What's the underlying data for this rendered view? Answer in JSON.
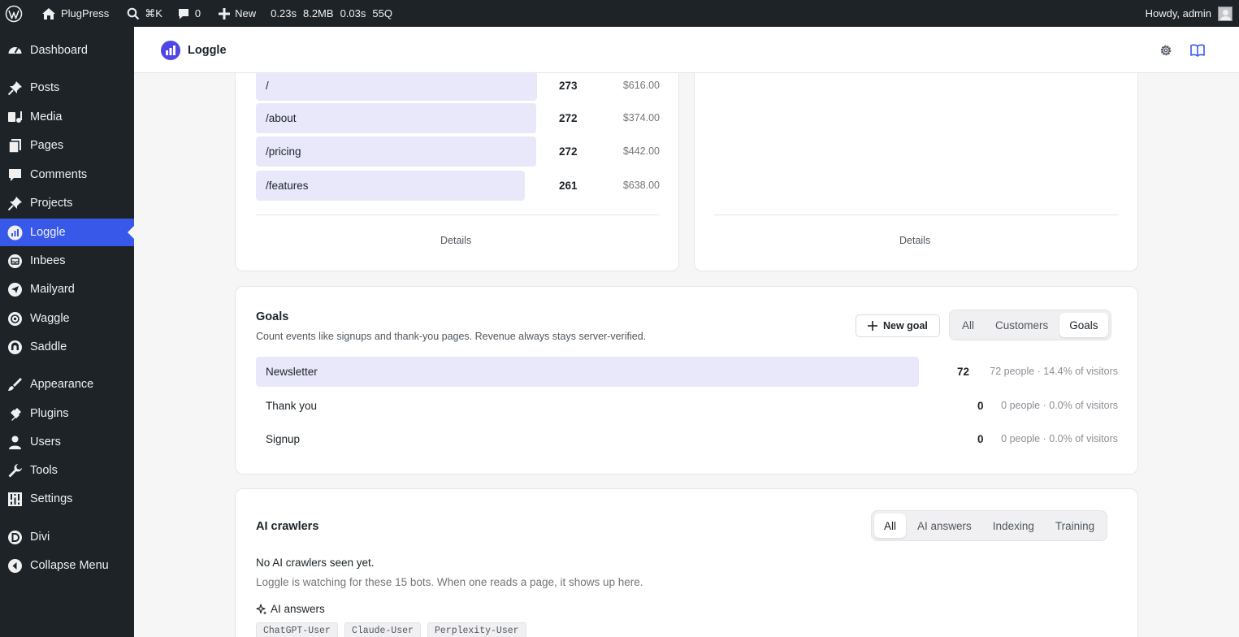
{
  "admin_bar": {
    "site_name": "PlugPress",
    "search_shortcut": "⌘K",
    "comments_count": "0",
    "new_label": "New",
    "perf": [
      "0.23s",
      "8.2MB",
      "0.03s",
      "55Q"
    ],
    "greeting": "Howdy, admin"
  },
  "sidebar": {
    "items": [
      {
        "label": "Dashboard",
        "icon": "dashboard-icon"
      },
      {
        "label": "Posts",
        "icon": "pin-icon"
      },
      {
        "label": "Media",
        "icon": "media-icon"
      },
      {
        "label": "Pages",
        "icon": "pages-icon"
      },
      {
        "label": "Comments",
        "icon": "comment-icon"
      },
      {
        "label": "Projects",
        "icon": "pin-icon"
      },
      {
        "label": "Loggle",
        "icon": "chart-icon",
        "current": true
      },
      {
        "label": "Inbees",
        "icon": "inbox-icon"
      },
      {
        "label": "Mailyard",
        "icon": "send-icon"
      },
      {
        "label": "Waggle",
        "icon": "waggle-icon"
      },
      {
        "label": "Saddle",
        "icon": "saddle-icon"
      },
      {
        "label": "Appearance",
        "icon": "brush-icon"
      },
      {
        "label": "Plugins",
        "icon": "plug-icon"
      },
      {
        "label": "Users",
        "icon": "user-icon"
      },
      {
        "label": "Tools",
        "icon": "wrench-icon"
      },
      {
        "label": "Settings",
        "icon": "settings-icon"
      },
      {
        "label": "Divi",
        "icon": "divi-icon"
      },
      {
        "label": "Collapse Menu",
        "icon": "collapse-icon"
      }
    ]
  },
  "plugin_header": {
    "title": "Loggle"
  },
  "pages_card": {
    "rows": [
      {
        "label": "/",
        "count": "273",
        "revenue": "$616.00",
        "share": 1.0
      },
      {
        "label": "/about",
        "count": "272",
        "revenue": "$374.00",
        "share": 0.996
      },
      {
        "label": "/pricing",
        "count": "272",
        "revenue": "$442.00",
        "share": 0.996
      },
      {
        "label": "/features",
        "count": "261",
        "revenue": "$638.00",
        "share": 0.956
      }
    ],
    "details_label": "Details"
  },
  "right_card": {
    "details_label": "Details"
  },
  "goals": {
    "title": "Goals",
    "subtitle": "Count events like signups and thank-you pages. Revenue always stays server-verified.",
    "new_goal_label": "New goal",
    "tabs": [
      {
        "label": "All",
        "active": false
      },
      {
        "label": "Customers",
        "active": false
      },
      {
        "label": "Goals",
        "active": true
      }
    ],
    "items": [
      {
        "label": "Newsletter",
        "count": "72",
        "sub": "72 people · 14.4% of visitors",
        "share": 1.0
      },
      {
        "label": "Thank you",
        "count": "0",
        "sub": "0 people · 0.0% of visitors",
        "share": 0
      },
      {
        "label": "Signup",
        "count": "0",
        "sub": "0 people · 0.0% of visitors",
        "share": 0
      }
    ]
  },
  "ai_crawlers": {
    "title": "AI crawlers",
    "tabs": [
      {
        "label": "All",
        "active": true
      },
      {
        "label": "AI answers",
        "active": false
      },
      {
        "label": "Indexing",
        "active": false
      },
      {
        "label": "Training",
        "active": false
      }
    ],
    "empty_title": "No AI crawlers seen yet.",
    "empty_sub": "Loggle is watching for these 15 bots. When one reads a page, it shows up here.",
    "section_label": "AI answers",
    "bots": [
      "ChatGPT-User",
      "Claude-User",
      "Perplexity-User"
    ]
  }
}
